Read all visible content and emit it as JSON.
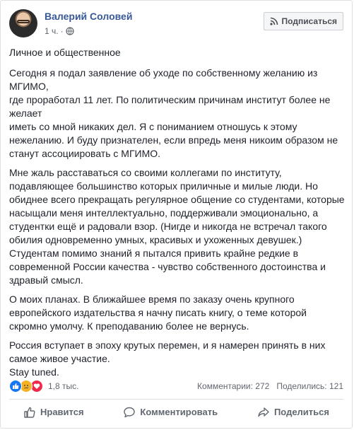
{
  "header": {
    "author": "Валерий Соловей",
    "time": "1 ч.",
    "subscribe_label": "Подписаться"
  },
  "post": {
    "title": "Личное и общественное",
    "paragraphs": [
      [
        "Сегодня я подал заявление об уходе по собственному желанию из",
        "МГИМО,",
        "где проработал 11 лет. По политическим причинам институт более не",
        "желает",
        "иметь со мной никаких дел. Я с пониманием отношусь к этому",
        "нежеланию. И буду признателен, если впредь меня никоим образом не",
        "станут ассоциировать с МГИМО."
      ],
      [
        "Мне жаль расставаться со своими коллегами по институту,",
        "подавляющее большинство которых приличные и милые люди. Но",
        "обиднее всего прекращать регулярное общение со студентами, которые",
        "насыщали меня интеллектуально, поддерживали эмоционально, а",
        "студентки ещё и радовали взор. (Нигде и никогда не встречал такого",
        "обилия одновременно умных, красивых и ухоженных девушек.)",
        "Студентам помимо знаний я пытался привить крайне редкие в",
        "современной России качества - чувство собственного достоинства и",
        "здравый смысл."
      ],
      [
        "О моих планах. В ближайшее время по заказу очень крупного",
        "европейского издательства я начну писать книгу, о теме которой",
        "скромно умолчу. К преподаванию более не вернусь."
      ],
      [
        "Россия вступает в эпоху крутых перемен, и я намерен принять в них",
        "самое живое участие.",
        "Stay tuned."
      ]
    ]
  },
  "stats": {
    "reactions_count": "1,8 тыс.",
    "comments": "Комментарии: 272",
    "shares": "Поделились: 121"
  },
  "actions": {
    "like": "Нравится",
    "comment": "Комментировать",
    "share": "Поделиться"
  },
  "icons": {
    "privacy": "globe-icon",
    "subscribe": "rss-icon",
    "like": "thumbs-up-icon",
    "comment": "speech-bubble-icon",
    "share": "share-arrow-icon"
  },
  "colors": {
    "author": "#385898",
    "like_reaction": "#1877f2",
    "sad_reaction": "#f7b125",
    "love_reaction": "#f0284a"
  }
}
